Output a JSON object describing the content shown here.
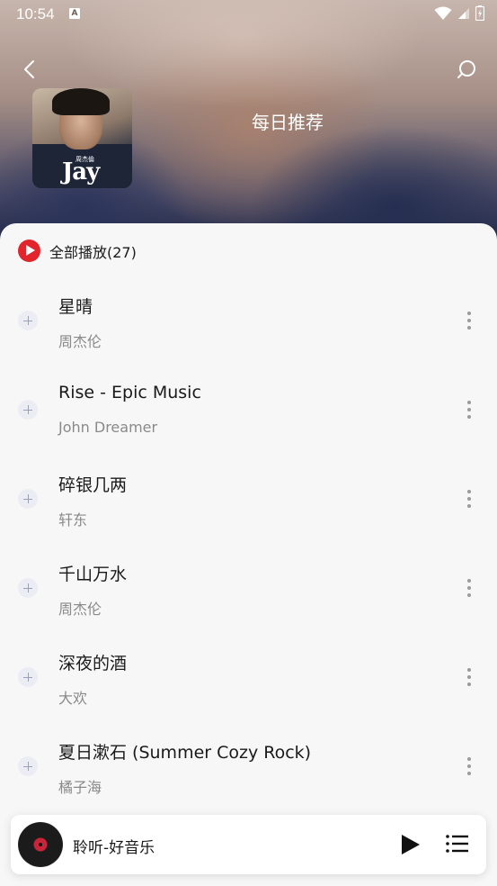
{
  "status_bar": {
    "time": "10:54",
    "notification_badge": "A"
  },
  "header": {
    "title": "每日推荐",
    "cover_text": "Jay",
    "cover_subtext": "周杰倫"
  },
  "play_all": {
    "label": "全部播放(27)"
  },
  "songs": [
    {
      "title": "星晴",
      "artist": "周杰伦"
    },
    {
      "title": "Rise - Epic Music",
      "artist": "John Dreamer"
    },
    {
      "title": "碎银几两",
      "artist": "轩东"
    },
    {
      "title": "千山万水",
      "artist": "周杰伦"
    },
    {
      "title": "深夜的酒",
      "artist": "大欢"
    },
    {
      "title": "夏日漱石 (Summer Cozy Rock)",
      "artist": "橘子海"
    }
  ],
  "mini_player": {
    "title": "聆听-好音乐"
  },
  "colors": {
    "accent_red": "#e2242c",
    "text_primary": "#1a1a1a",
    "text_secondary": "#8a8a8a"
  }
}
